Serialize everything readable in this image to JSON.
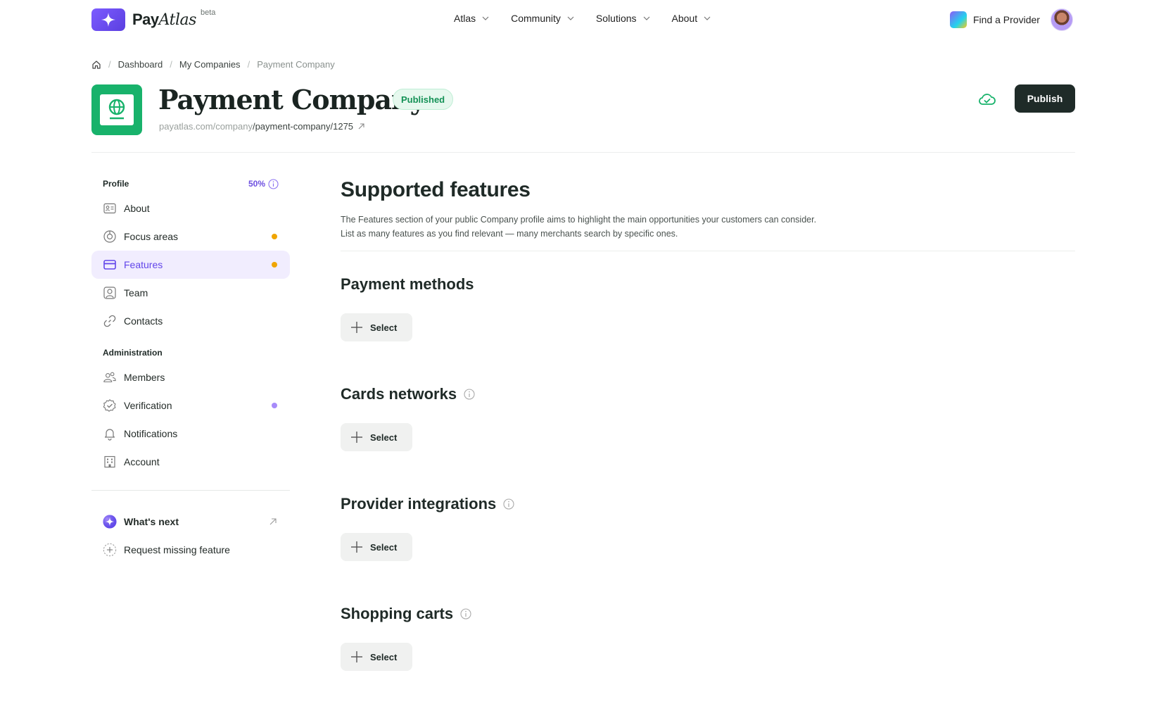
{
  "brand": {
    "name_a": "Pay",
    "name_b": "Atlas",
    "beta": "beta",
    "primary": "#6246ea"
  },
  "nav": {
    "items": [
      {
        "label": "Atlas"
      },
      {
        "label": "Community"
      },
      {
        "label": "Solutions"
      },
      {
        "label": "About"
      }
    ],
    "find_provider": "Find a Provider"
  },
  "breadcrumb": {
    "items": [
      "Dashboard",
      "My Companies"
    ],
    "current": "Payment Company"
  },
  "company": {
    "name": "Payment Company",
    "status": "Published",
    "url_base": "payatlas.com/company",
    "url_path": "/payment-company/1275",
    "publish_label": "Publish",
    "logo_color": "#18b26b"
  },
  "sidebar": {
    "profile_heading": "Profile",
    "progress": "50%",
    "profile_items": [
      {
        "label": "About",
        "icon": "id-card-icon"
      },
      {
        "label": "Focus areas",
        "icon": "target-icon",
        "dot": "#f0a500"
      },
      {
        "label": "Features",
        "icon": "credit-card-icon",
        "dot": "#f0a500",
        "active": true
      },
      {
        "label": "Team",
        "icon": "user-square-icon"
      },
      {
        "label": "Contacts",
        "icon": "link-icon"
      }
    ],
    "admin_heading": "Administration",
    "admin_items": [
      {
        "label": "Members",
        "icon": "users-icon"
      },
      {
        "label": "Verification",
        "icon": "badge-check-icon",
        "dot": "#a78bfa"
      },
      {
        "label": "Notifications",
        "icon": "bell-icon"
      },
      {
        "label": "Account",
        "icon": "building-icon"
      }
    ],
    "whats_next": "What's next",
    "request_feature": "Request missing feature"
  },
  "main": {
    "title": "Supported features",
    "description": "The Features section of your public Company profile aims to highlight the main opportunities your customers can consider. List as many features as you find relevant — many merchants search by specific ones.",
    "sections": [
      {
        "title": "Payment methods",
        "info": false,
        "button": "Select"
      },
      {
        "title": "Cards networks",
        "info": true,
        "button": "Select"
      },
      {
        "title": "Provider integrations",
        "info": true,
        "button": "Select"
      },
      {
        "title": "Shopping carts",
        "info": true,
        "button": "Select"
      }
    ]
  }
}
